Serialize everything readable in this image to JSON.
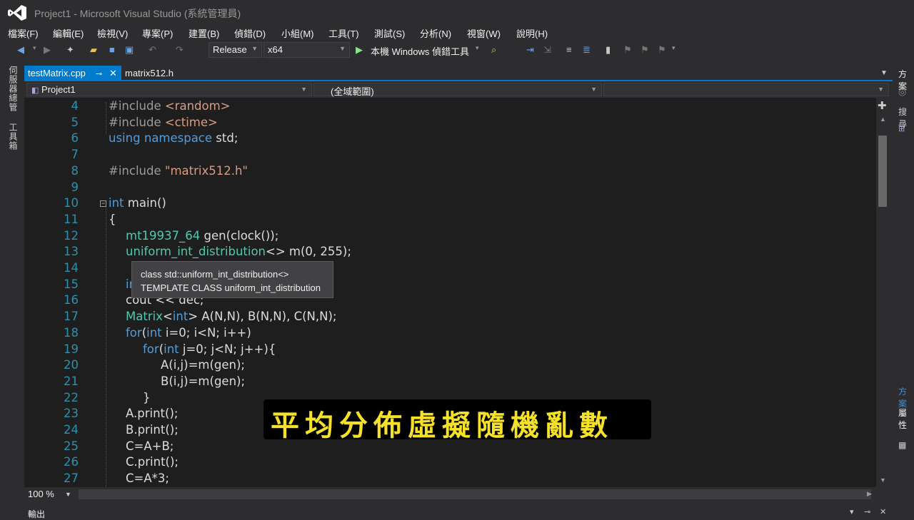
{
  "window": {
    "title": "Project1 - Microsoft Visual Studio (系統管理員)"
  },
  "menu": {
    "items": [
      "檔案(F)",
      "編輯(E)",
      "檢視(V)",
      "專案(P)",
      "建置(B)",
      "偵錯(D)",
      "小組(M)",
      "工具(T)",
      "測試(S)",
      "分析(N)",
      "視窗(W)",
      "說明(H)"
    ]
  },
  "toolbar": {
    "configuration": "Release",
    "platform": "x64",
    "run_label": "本機 Windows 偵錯工具"
  },
  "left_strip": {
    "server_explorer": "伺服器總管",
    "toolbox": "工具箱"
  },
  "tabs": [
    {
      "label": "testMatrix.cpp",
      "active": true
    },
    {
      "label": "matrix512.h",
      "active": false
    }
  ],
  "navbar": {
    "project": "Project1",
    "scope": "(全域範圍)"
  },
  "editor": {
    "lines": [
      {
        "num": "4",
        "tokens": [
          [
            "#include ",
            "#9b9b9b"
          ],
          [
            "<random>",
            "#d69d85"
          ]
        ]
      },
      {
        "num": "5",
        "tokens": [
          [
            "#include ",
            "#9b9b9b"
          ],
          [
            "<ctime>",
            "#d69d85"
          ]
        ]
      },
      {
        "num": "6",
        "tokens": [
          [
            "using",
            "#569cd6"
          ],
          [
            " ",
            "#dcdcdc"
          ],
          [
            "namespace",
            "#569cd6"
          ],
          [
            " std;",
            "#dcdcdc"
          ]
        ]
      },
      {
        "num": "7",
        "tokens": []
      },
      {
        "num": "8",
        "tokens": [
          [
            "#include ",
            "#9b9b9b"
          ],
          [
            "\"matrix512.h\"",
            "#d69d85"
          ]
        ]
      },
      {
        "num": "9",
        "tokens": []
      },
      {
        "num": "10",
        "tokens": [
          [
            "int",
            "#569cd6"
          ],
          [
            " main()",
            "#dcdcdc"
          ]
        ]
      },
      {
        "num": "11",
        "tokens": [
          [
            "{",
            "#dcdcdc"
          ]
        ]
      },
      {
        "num": "12",
        "tokens": [
          [
            "mt19937_64",
            "#4ec9b0"
          ],
          [
            " gen(clock());",
            "#dcdcdc"
          ]
        ]
      },
      {
        "num": "13",
        "tokens": [
          [
            "uniform_int_distribution",
            "#4ec9b0"
          ],
          [
            "<> m(0, 255);",
            "#dcdcdc"
          ]
        ]
      },
      {
        "num": "14",
        "tokens": []
      },
      {
        "num": "15",
        "tokens": [
          [
            "in",
            "#569cd6"
          ]
        ]
      },
      {
        "num": "16",
        "tokens": [
          [
            "cout << dec;",
            "#dcdcdc"
          ]
        ]
      },
      {
        "num": "17",
        "tokens": [
          [
            "Matrix",
            "#4ec9b0"
          ],
          [
            "<",
            "#dcdcdc"
          ],
          [
            "int",
            "#569cd6"
          ],
          [
            "> A(N,N), B(N,N), C(N,N);",
            "#dcdcdc"
          ]
        ]
      },
      {
        "num": "18",
        "tokens": [
          [
            "for",
            "#569cd6"
          ],
          [
            "(",
            "#dcdcdc"
          ],
          [
            "int",
            "#569cd6"
          ],
          [
            " i=0; i<N; i++)",
            "#dcdcdc"
          ]
        ]
      },
      {
        "num": "19",
        "tokens": [
          [
            "for",
            "#569cd6"
          ],
          [
            "(",
            "#dcdcdc"
          ],
          [
            "int",
            "#569cd6"
          ],
          [
            " j=0; j<N; j++){",
            "#dcdcdc"
          ]
        ]
      },
      {
        "num": "20",
        "tokens": [
          [
            "A(i,j)=m(gen);",
            "#dcdcdc"
          ]
        ]
      },
      {
        "num": "21",
        "tokens": [
          [
            "B(i,j)=m(gen);",
            "#dcdcdc"
          ]
        ]
      },
      {
        "num": "22",
        "tokens": [
          [
            "}",
            "#dcdcdc"
          ]
        ]
      },
      {
        "num": "23",
        "tokens": [
          [
            "A.print();",
            "#dcdcdc"
          ]
        ]
      },
      {
        "num": "24",
        "tokens": [
          [
            "B.print();",
            "#dcdcdc"
          ]
        ]
      },
      {
        "num": "25",
        "tokens": [
          [
            "C=A+B;",
            "#dcdcdc"
          ]
        ]
      },
      {
        "num": "26",
        "tokens": [
          [
            "C.print();",
            "#dcdcdc"
          ]
        ]
      },
      {
        "num": "27",
        "tokens": [
          [
            "C=A*3;",
            "#dcdcdc"
          ]
        ]
      }
    ]
  },
  "tooltip": {
    "line1": "class std::uniform_int_distribution<>",
    "line2": "TEMPLATE CLASS uniform_int_distribution"
  },
  "subtitle": "平均分佈虛擬隨機亂數",
  "status": {
    "zoom": "100 %"
  },
  "right_panel": {
    "solution_title": "方案",
    "search": "搜尋",
    "solution_link": "方案",
    "properties": "屬性"
  },
  "bottom": {
    "output_label": "輸出"
  },
  "colors": {
    "accent": "#007acc",
    "editor_bg": "#1e1e1e",
    "line_number": "#2b91af",
    "subtitle_text": "#f5e12a"
  }
}
